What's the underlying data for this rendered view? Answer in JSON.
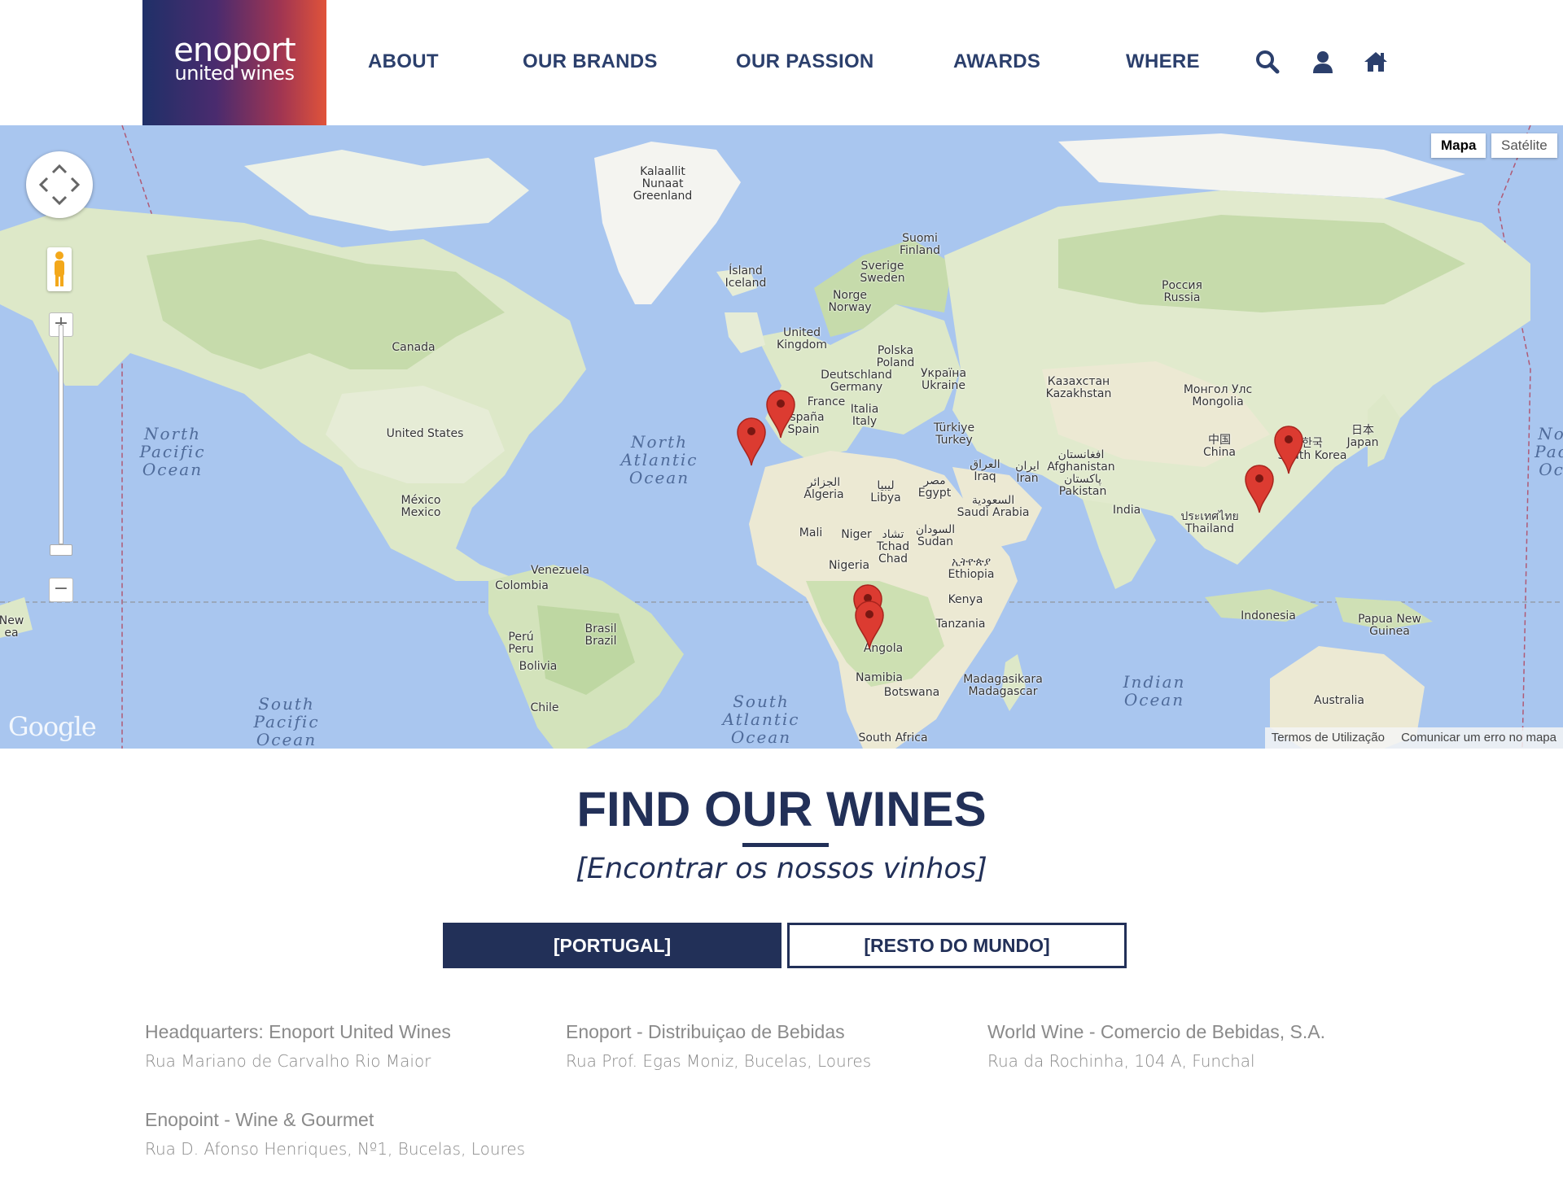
{
  "brand": {
    "logo_line1": "enoport",
    "logo_line2": "united wines"
  },
  "nav": {
    "items": [
      "ABOUT",
      "OUR BRANDS",
      "OUR PASSION",
      "AWARDS",
      "WHERE"
    ],
    "icons": [
      "search-icon",
      "user-icon",
      "home-icon"
    ]
  },
  "map": {
    "type_buttons": [
      "Mapa",
      "Satélite"
    ],
    "selected_type": "Mapa",
    "footer_links": [
      "Termos de Utilização",
      "Comunicar um erro no mapa"
    ],
    "attribution": "Google",
    "zoom_in": "+",
    "zoom_out": "−",
    "oceans": [
      "North\nPacific\nOcean",
      "North\nAtlantic\nOcean",
      "South\nPacific\nOcean",
      "South\nAtlantic\nOcean",
      "Indian\nOcean",
      "No\nPac\nOc"
    ],
    "places": [
      "Kalaallit\nNunaat\nGreenland",
      "Ísland\nIceland",
      "Suomi\nFinland",
      "Sverige\nSweden",
      "Norge\nNorway",
      "United\nKingdom",
      "Polska\nPoland",
      "Deutschland\nGermany",
      "Україна\nUkraine",
      "France",
      "Italia\nItaly",
      "España\nSpain",
      "Türkiye\nTurkey",
      "Россия\nRussia",
      "Казахстан\nKazakhstan",
      "Монгол Улс\nMongolia",
      "中国\nChina",
      "日本\nJapan",
      "한국\nSouth Korea",
      "العراق\nIraq",
      "ایران\nIran",
      "افغانستان\nAfghanistan",
      "پاکستان\nPakistan",
      "India",
      "ประเทศไทย\nThailand",
      "Canada",
      "United States",
      "México\nMexico",
      "Venezuela",
      "Colombia",
      "Perú\nPeru",
      "Brasil\nBrazil",
      "Bolivia",
      "Chile",
      "الجزائر\nAlgeria",
      "ليبيا\nLibya",
      "مصر\nEgypt",
      "السعودية\nSaudi Arabia",
      "Mali",
      "Niger",
      "تشاد\nTchad\nChad",
      "السودان\nSudan",
      "ኢትዮጵያ\nEthiopia",
      "Nigeria",
      "Kenya",
      "Tanzania",
      "Angola",
      "Namibia",
      "Botswana",
      "Madagasikara\nMadagascar",
      "South Africa",
      "Indonesia",
      "Papua New\nGuinea",
      "Australia",
      "New\nea"
    ],
    "pin_count": 6
  },
  "find": {
    "title": "FIND OUR WINES",
    "subtitle": "[Encontrar os nossos vinhos]",
    "tabs": [
      "[PORTUGAL]",
      "[RESTO DO MUNDO]"
    ],
    "active_tab": "[PORTUGAL]"
  },
  "locations": [
    {
      "name": "Headquarters: Enoport United Wines",
      "address": "Rua Mariano de Carvalho Rio Maior"
    },
    {
      "name": "Enoport - Distribuiçao de Bebidas",
      "address": "Rua Prof. Egas Moniz, Bucelas, Loures"
    },
    {
      "name": "World Wine - Comercio de Bebidas, S.A.",
      "address": "Rua da Rochinha, 104 A, Funchal"
    },
    {
      "name": "Enopoint - Wine & Gourmet",
      "address": "Rua D. Afonso Henriques, Nº1, Bucelas, Loures"
    }
  ],
  "colors": {
    "navy": "#223058",
    "nav_text": "#2b3f6c",
    "ocean": "#a9c6ef",
    "land": "#e8eed8",
    "forest": "#c7dcae",
    "pin": "#dc3b31",
    "address_text": "#8a8a8a"
  }
}
